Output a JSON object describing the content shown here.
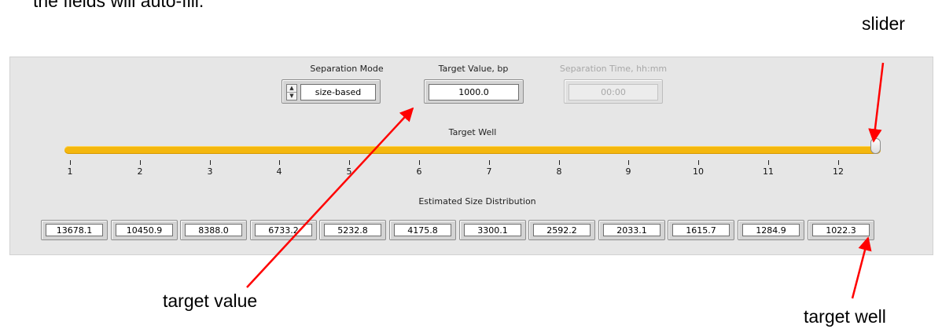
{
  "doc_text": "the fields will auto-fill.",
  "panel": {
    "separation_mode": {
      "label": "Separation Mode",
      "value": "size-based"
    },
    "target_value": {
      "label": "Target Value,  bp",
      "value": "1000.0"
    },
    "separation_time": {
      "label": "Separation Time, hh:mm",
      "value": "00:00"
    },
    "target_well": {
      "label": "Target Well",
      "ticks": [
        "1",
        "2",
        "3",
        "4",
        "5",
        "6",
        "7",
        "8",
        "9",
        "10",
        "11",
        "12"
      ],
      "selected": 12
    },
    "distribution": {
      "label": "Estimated Size Distribution",
      "values": [
        "13678.1",
        "10450.9",
        "8388.0",
        "6733.2",
        "5232.8",
        "4175.8",
        "3300.1",
        "2592.2",
        "2033.1",
        "1615.7",
        "1284.9",
        "1022.3"
      ]
    }
  },
  "callouts": {
    "slider": "slider",
    "target_value": "target value",
    "target_well": "target well"
  },
  "colors": {
    "track": "#f4b70e",
    "arrow": "#ff0000",
    "panel": "#e6e6e6"
  }
}
